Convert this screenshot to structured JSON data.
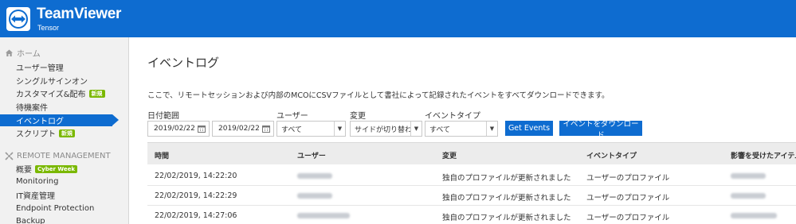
{
  "brand": {
    "name": "TeamViewer",
    "sub": "Tensor"
  },
  "sidebar": {
    "home_label": "ホーム",
    "items": [
      {
        "label": "ユーザー管理"
      },
      {
        "label": "シングルサインオン"
      },
      {
        "label": "カスタマイズ&配布",
        "badge": "新規"
      },
      {
        "label": "待機案件"
      },
      {
        "label": "イベントログ"
      },
      {
        "label": "スクリプト",
        "badge": "新規"
      }
    ],
    "remote_label": "REMOTE MANAGEMENT",
    "remote_items": [
      {
        "label": "概要",
        "badge": "Cyber Week"
      },
      {
        "label": "Monitoring"
      },
      {
        "label": "IT資産管理"
      },
      {
        "label": "Endpoint Protection"
      },
      {
        "label": "Backup"
      }
    ]
  },
  "main": {
    "title": "イベントログ",
    "description": "ここで、リモートセッションおよび内部のMCOにCSVファイルとして書社によって記録されたイベントをすべてダウンロードできます。"
  },
  "filters": {
    "date_label": "日付範囲",
    "date_from": "2019/02/22",
    "date_to": "2019/02/22",
    "user_label": "ユーザー",
    "user_value": "すべて",
    "change_label": "変更",
    "change_value": "サイドが切り替わり",
    "event_type_label": "イベントタイプ",
    "event_type_value": "すべて",
    "get_events": "Get Events",
    "download": "イベントをダウンロード"
  },
  "table": {
    "headers": [
      "時間",
      "ユーザー",
      "変更",
      "イベントタイプ",
      "影響を受けたアイテム"
    ],
    "rows": [
      {
        "time": "22/02/2019, 14:22:20",
        "change": "独自のプロファイルが更新されました",
        "event_type": "ユーザーのプロファイル"
      },
      {
        "time": "22/02/2019, 14:22:29",
        "change": "独自のプロファイルが更新されました",
        "event_type": "ユーザーのプロファイル"
      },
      {
        "time": "22/02/2019, 14:27:06",
        "change": "独自のプロファイルが更新されました",
        "event_type": "ユーザーのプロファイル"
      }
    ]
  },
  "colors": {
    "accent": "#0e6cd0",
    "badge": "#7ab800"
  },
  "icons": [
    "teamviewer-logo-icon",
    "home-icon",
    "remote-management-icon",
    "calendar-icon",
    "chevron-down-icon"
  ]
}
